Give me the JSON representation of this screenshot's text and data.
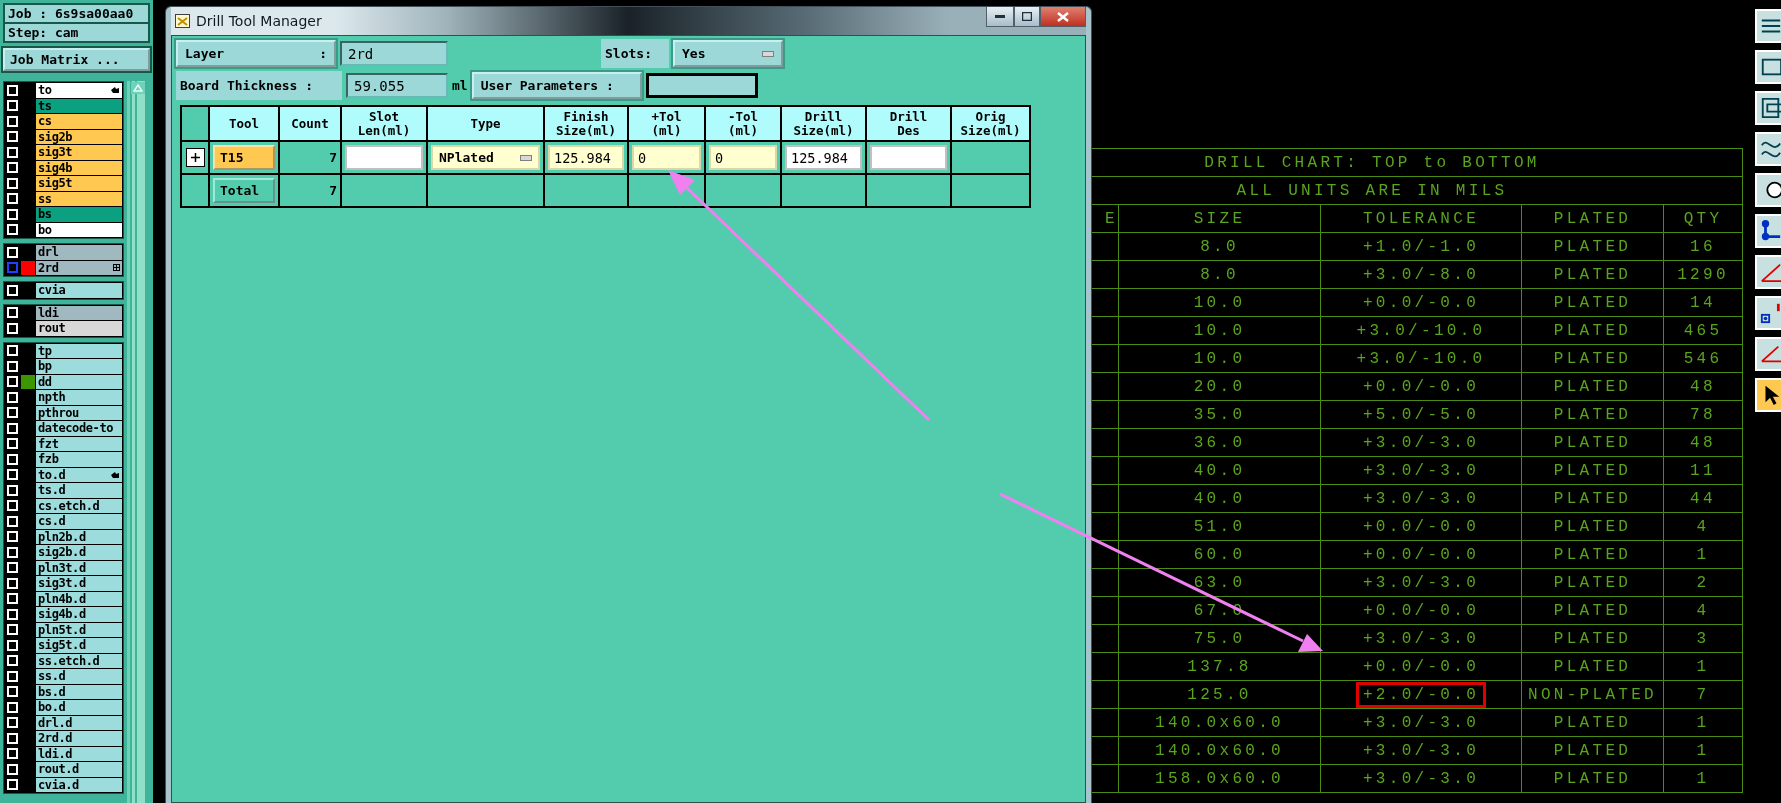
{
  "left_panel": {
    "job": {
      "label": "Job :",
      "value": "6s9sa00aa0"
    },
    "step": {
      "label": "Step:",
      "value": "cam"
    },
    "job_matrix_button": "Job Matrix ...",
    "groups": [
      {
        "layers": [
          {
            "name": "to",
            "color": "#ffffff",
            "checked": false,
            "active": false,
            "hand": true,
            "expandable": false
          },
          {
            "name": "ts",
            "color": "#0aa080",
            "checked": false,
            "active": false,
            "hand": false,
            "expandable": false
          },
          {
            "name": "cs",
            "color": "#ffc850",
            "checked": false,
            "active": false,
            "hand": false,
            "expandable": false
          },
          {
            "name": "sig2b",
            "color": "#ffc850",
            "checked": false,
            "active": false,
            "hand": false,
            "expandable": false
          },
          {
            "name": "sig3t",
            "color": "#ffc850",
            "checked": false,
            "active": false,
            "hand": false,
            "expandable": false
          },
          {
            "name": "sig4b",
            "color": "#ffc850",
            "checked": false,
            "active": false,
            "hand": false,
            "expandable": false
          },
          {
            "name": "sig5t",
            "color": "#ffc850",
            "checked": false,
            "active": false,
            "hand": false,
            "expandable": false
          },
          {
            "name": "ss",
            "color": "#ffc850",
            "checked": false,
            "active": false,
            "hand": false,
            "expandable": false
          },
          {
            "name": "bs",
            "color": "#0aa080",
            "checked": false,
            "active": false,
            "hand": false,
            "expandable": false
          },
          {
            "name": "bo",
            "color": "#ffffff",
            "checked": false,
            "active": false,
            "hand": false,
            "expandable": false
          }
        ]
      },
      {
        "layers": [
          {
            "name": "drl",
            "color": "#a0b8c0",
            "checked": false,
            "active": false,
            "hand": false,
            "expandable": false
          },
          {
            "name": "2rd",
            "color": "#a0b8c0",
            "swatch": {
              "color": "#ff0000"
            },
            "checked": false,
            "active": true,
            "hand": false,
            "expandable": true
          }
        ]
      },
      {
        "layers": [
          {
            "name": "cvia",
            "color": "#9cdcdc",
            "checked": false,
            "active": false,
            "hand": false,
            "expandable": false
          }
        ]
      },
      {
        "layers": [
          {
            "name": "ldi",
            "color": "#a0b8c0",
            "checked": false,
            "active": false,
            "hand": false,
            "expandable": false
          },
          {
            "name": "rout",
            "color": "#d8d8d8",
            "checked": false,
            "active": false,
            "hand": false,
            "expandable": false
          }
        ]
      },
      {
        "layers": [
          {
            "name": "tp",
            "color": "#9cdcdc",
            "checked": false,
            "active": false,
            "hand": false,
            "expandable": false
          },
          {
            "name": "bp",
            "color": "#9cdcdc",
            "checked": false,
            "active": false,
            "hand": false,
            "expandable": false
          },
          {
            "name": "dd",
            "color": "#9cdcdc",
            "swatch": {
              "color": "#3c9600"
            },
            "checked": false,
            "active": false,
            "hand": false,
            "expandable": false
          },
          {
            "name": "npth",
            "color": "#9cdcdc",
            "checked": false,
            "active": false,
            "hand": false,
            "expandable": false
          },
          {
            "name": "pthrou",
            "color": "#9cdcdc",
            "checked": false,
            "active": false,
            "hand": false,
            "expandable": false
          },
          {
            "name": "datecode-to",
            "color": "#9cdcdc",
            "checked": false,
            "active": false,
            "hand": false,
            "expandable": false
          },
          {
            "name": "fzt",
            "color": "#9cdcdc",
            "checked": false,
            "active": false,
            "hand": false,
            "expandable": false
          },
          {
            "name": "fzb",
            "color": "#9cdcdc",
            "checked": false,
            "active": false,
            "hand": false,
            "expandable": false
          },
          {
            "name": "to.d",
            "color": "#9cdcdc",
            "checked": false,
            "active": false,
            "hand": true,
            "expandable": false
          },
          {
            "name": "ts.d",
            "color": "#9cdcdc",
            "checked": false,
            "active": false,
            "hand": false,
            "expandable": false
          },
          {
            "name": "cs.etch.d",
            "color": "#9cdcdc",
            "checked": false,
            "active": false,
            "hand": false,
            "expandable": false
          },
          {
            "name": "cs.d",
            "color": "#9cdcdc",
            "checked": false,
            "active": false,
            "hand": false,
            "expandable": false
          },
          {
            "name": "pln2b.d",
            "color": "#9cdcdc",
            "checked": false,
            "active": false,
            "hand": false,
            "expandable": false
          },
          {
            "name": "sig2b.d",
            "color": "#9cdcdc",
            "checked": false,
            "active": false,
            "hand": false,
            "expandable": false
          },
          {
            "name": "pln3t.d",
            "color": "#9cdcdc",
            "checked": false,
            "active": false,
            "hand": false,
            "expandable": false
          },
          {
            "name": "sig3t.d",
            "color": "#9cdcdc",
            "checked": false,
            "active": false,
            "hand": false,
            "expandable": false
          },
          {
            "name": "pln4b.d",
            "color": "#9cdcdc",
            "checked": false,
            "active": false,
            "hand": false,
            "expandable": false
          },
          {
            "name": "sig4b.d",
            "color": "#9cdcdc",
            "checked": false,
            "active": false,
            "hand": false,
            "expandable": false
          },
          {
            "name": "pln5t.d",
            "color": "#9cdcdc",
            "checked": false,
            "active": false,
            "hand": false,
            "expandable": false
          },
          {
            "name": "sig5t.d",
            "color": "#9cdcdc",
            "checked": false,
            "active": false,
            "hand": false,
            "expandable": false
          },
          {
            "name": "ss.etch.d",
            "color": "#9cdcdc",
            "checked": false,
            "active": false,
            "hand": false,
            "expandable": false
          },
          {
            "name": "ss.d",
            "color": "#9cdcdc",
            "checked": false,
            "active": false,
            "hand": false,
            "expandable": false
          },
          {
            "name": "bs.d",
            "color": "#9cdcdc",
            "checked": false,
            "active": false,
            "hand": false,
            "expandable": false
          },
          {
            "name": "bo.d",
            "color": "#9cdcdc",
            "checked": false,
            "active": false,
            "hand": false,
            "expandable": false
          },
          {
            "name": "drl.d",
            "color": "#9cdcdc",
            "checked": false,
            "active": false,
            "hand": false,
            "expandable": false
          },
          {
            "name": "2rd.d",
            "color": "#9cdcdc",
            "checked": false,
            "active": false,
            "hand": false,
            "expandable": false
          },
          {
            "name": "ldi.d",
            "color": "#9cdcdc",
            "checked": false,
            "active": false,
            "hand": false,
            "expandable": false
          },
          {
            "name": "rout.d",
            "color": "#9cdcdc",
            "checked": false,
            "active": false,
            "hand": false,
            "expandable": false
          },
          {
            "name": "cvia.d",
            "color": "#9cdcdc",
            "checked": false,
            "active": false,
            "hand": false,
            "expandable": false
          }
        ]
      }
    ]
  },
  "dialog": {
    "title": "Drill Tool Manager",
    "layer": {
      "label": "Layer",
      "colon": ":",
      "value": "2rd"
    },
    "slots": {
      "label": "Slots:",
      "value": "Yes"
    },
    "board_thickness": {
      "label": "Board Thickness :",
      "value": "59.055",
      "unit": "ml"
    },
    "user_parameters": {
      "label": "User Parameters :"
    },
    "table": {
      "columns": [
        "Tool",
        "Count",
        "Slot\nLen(ml)",
        "Type",
        "Finish\nSize(ml)",
        "+Tol\n(ml)",
        "-Tol\n(ml)",
        "Drill\nSize(ml)",
        "Drill\nDes",
        "Orig\nSize(ml)"
      ],
      "rows": [
        {
          "kind": "tool",
          "expanded": false,
          "cells": [
            {
              "kind": "button",
              "text": "T15",
              "tinted": true
            },
            {
              "kind": "text",
              "text": "7"
            },
            {
              "kind": "field",
              "tinted": false
            },
            {
              "kind": "option",
              "text": "NPlated"
            },
            {
              "kind": "field",
              "text": "125.984",
              "tinted": true
            },
            {
              "kind": "field",
              "text": "0",
              "tinted": true
            },
            {
              "kind": "field",
              "text": "0",
              "tinted": true
            },
            {
              "kind": "field",
              "text": "125.984",
              "tinted": false
            },
            {
              "kind": "field",
              "tinted": false
            },
            {
              "kind": "empty"
            }
          ]
        },
        {
          "kind": "total",
          "cells": [
            {
              "kind": "button",
              "text": "Total",
              "tinted": false
            },
            {
              "kind": "text",
              "text": "7"
            },
            {
              "kind": "empty"
            },
            {
              "kind": "empty"
            },
            {
              "kind": "empty"
            },
            {
              "kind": "empty"
            },
            {
              "kind": "empty"
            },
            {
              "kind": "empty"
            },
            {
              "kind": "empty"
            },
            {
              "kind": "empty"
            }
          ]
        }
      ]
    }
  },
  "drill_chart": {
    "title": "DRILL CHART: TOP to BOTTOM",
    "units": "ALL UNITS ARE IN MILS",
    "columns": [
      "E",
      "SIZE",
      "TOLERANCE",
      "PLATED",
      "QTY"
    ],
    "rows": [
      {
        "size": "8.0",
        "tolerance": "+1.0/-1.0",
        "plated": "PLATED",
        "qty": "16",
        "highlighted": false
      },
      {
        "size": "8.0",
        "tolerance": "+3.0/-8.0",
        "plated": "PLATED",
        "qty": "1290",
        "highlighted": false
      },
      {
        "size": "10.0",
        "tolerance": "+0.0/-0.0",
        "plated": "PLATED",
        "qty": "14",
        "highlighted": false
      },
      {
        "size": "10.0",
        "tolerance": "+3.0/-10.0",
        "plated": "PLATED",
        "qty": "465",
        "highlighted": false
      },
      {
        "size": "10.0",
        "tolerance": "+3.0/-10.0",
        "plated": "PLATED",
        "qty": "546",
        "highlighted": false
      },
      {
        "size": "20.0",
        "tolerance": "+0.0/-0.0",
        "plated": "PLATED",
        "qty": "48",
        "highlighted": false
      },
      {
        "size": "35.0",
        "tolerance": "+5.0/-5.0",
        "plated": "PLATED",
        "qty": "78",
        "highlighted": false
      },
      {
        "size": "36.0",
        "tolerance": "+3.0/-3.0",
        "plated": "PLATED",
        "qty": "48",
        "highlighted": false
      },
      {
        "size": "40.0",
        "tolerance": "+3.0/-3.0",
        "plated": "PLATED",
        "qty": "11",
        "highlighted": false
      },
      {
        "size": "40.0",
        "tolerance": "+3.0/-3.0",
        "plated": "PLATED",
        "qty": "44",
        "highlighted": false
      },
      {
        "size": "51.0",
        "tolerance": "+0.0/-0.0",
        "plated": "PLATED",
        "qty": "4",
        "highlighted": false
      },
      {
        "size": "60.0",
        "tolerance": "+0.0/-0.0",
        "plated": "PLATED",
        "qty": "1",
        "highlighted": false
      },
      {
        "size": "63.0",
        "tolerance": "+3.0/-3.0",
        "plated": "PLATED",
        "qty": "2",
        "highlighted": false
      },
      {
        "size": "67.0",
        "tolerance": "+0.0/-0.0",
        "plated": "PLATED",
        "qty": "4",
        "highlighted": false
      },
      {
        "size": "75.0",
        "tolerance": "+3.0/-3.0",
        "plated": "PLATED",
        "qty": "3",
        "highlighted": false
      },
      {
        "size": "137.8",
        "tolerance": "+0.0/-0.0",
        "plated": "PLATED",
        "qty": "1",
        "highlighted": false
      },
      {
        "size": "125.0",
        "tolerance": "+2.0/-0.0",
        "plated": "NON-PLATED",
        "qty": "7",
        "highlighted": true
      },
      {
        "size": "140.0x60.0",
        "tolerance": "+3.0/-3.0",
        "plated": "PLATED",
        "qty": "1",
        "highlighted": false
      },
      {
        "size": "140.0x60.0",
        "tolerance": "+3.0/-3.0",
        "plated": "PLATED",
        "qty": "1",
        "highlighted": false
      },
      {
        "size": "158.0x60.0",
        "tolerance": "+3.0/-3.0",
        "plated": "PLATED",
        "qty": "1",
        "highlighted": false
      }
    ]
  }
}
